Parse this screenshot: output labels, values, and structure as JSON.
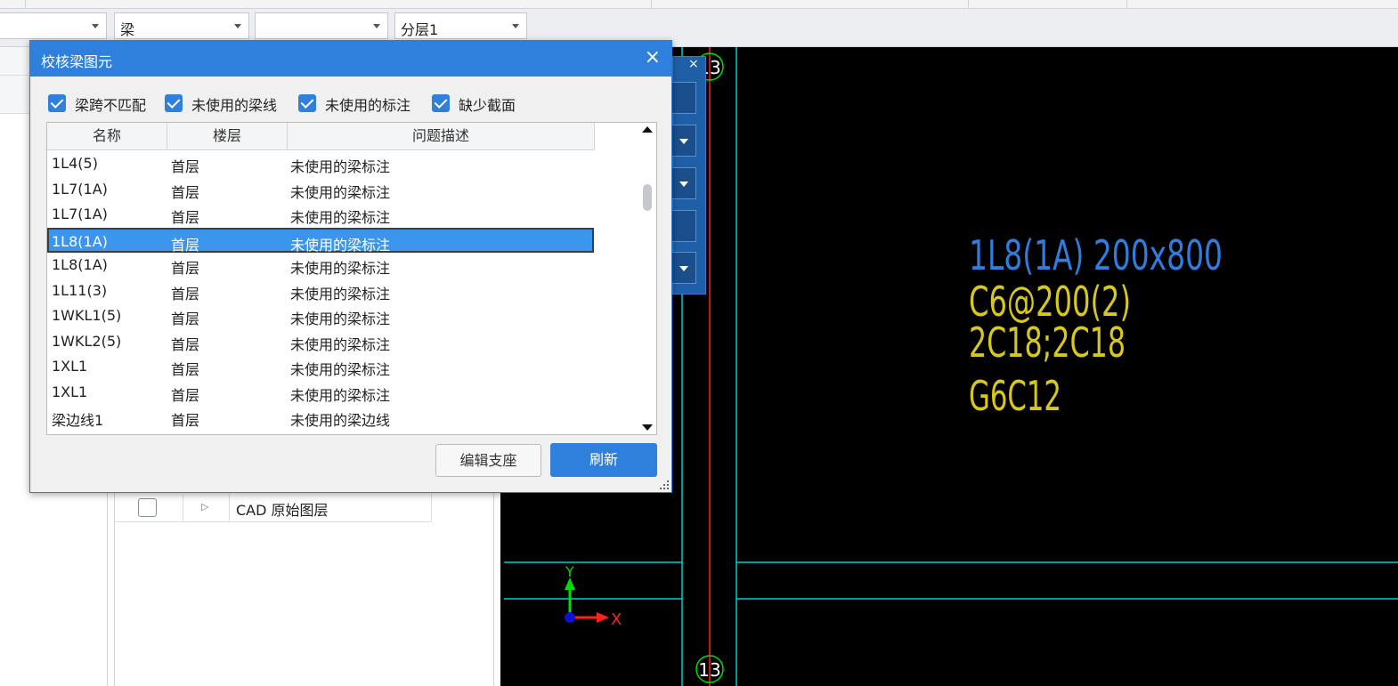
{
  "toolbar": {
    "combo1": "",
    "combo2": "梁",
    "combo3": "",
    "combo4": "分层1"
  },
  "dialog": {
    "title": "校核梁图元",
    "close": "×",
    "filters": [
      "梁跨不匹配",
      "未使用的梁线",
      "未使用的标注",
      "缺少截面"
    ],
    "columns": [
      "名称",
      "楼层",
      "问题描述"
    ],
    "rows": [
      {
        "name": "1L4(5)",
        "floor": "首层",
        "issue": "未使用的梁标注"
      },
      {
        "name": "1L7(1A)",
        "floor": "首层",
        "issue": "未使用的梁标注"
      },
      {
        "name": "1L7(1A)",
        "floor": "首层",
        "issue": "未使用的梁标注"
      },
      {
        "name": "1L8(1A)",
        "floor": "首层",
        "issue": "未使用的梁标注"
      },
      {
        "name": "1L8(1A)",
        "floor": "首层",
        "issue": "未使用的梁标注"
      },
      {
        "name": "1L11(3)",
        "floor": "首层",
        "issue": "未使用的梁标注"
      },
      {
        "name": "1WKL1(5)",
        "floor": "首层",
        "issue": "未使用的梁标注"
      },
      {
        "name": "1WKL2(5)",
        "floor": "首层",
        "issue": "未使用的梁标注"
      },
      {
        "name": "1XL1",
        "floor": "首层",
        "issue": "未使用的梁标注"
      },
      {
        "name": "1XL1",
        "floor": "首层",
        "issue": "未使用的梁标注"
      },
      {
        "name": "梁边线1",
        "floor": "首层",
        "issue": "未使用的梁边线"
      }
    ],
    "selected_row": 3,
    "buttons": {
      "edit": "编辑支座",
      "refresh": "刷新"
    }
  },
  "layers": {
    "row_label": "CAD 原始图层"
  },
  "float_panel": {
    "close": "×"
  },
  "cad": {
    "axis_top": "13",
    "axis_bottom": "13",
    "beam_label": "1L8(1A) 200x800",
    "stirrup": "C6@200(2)",
    "rebar": "2C18;2C18",
    "side_rebar": "G6C12",
    "y_label": "Y",
    "x_label": "X",
    "colors": {
      "cyan": "#00d0d0",
      "red": "#ff2020",
      "blue": "#2f7de0",
      "yellow": "#d8c81c",
      "green": "#00e000"
    }
  }
}
